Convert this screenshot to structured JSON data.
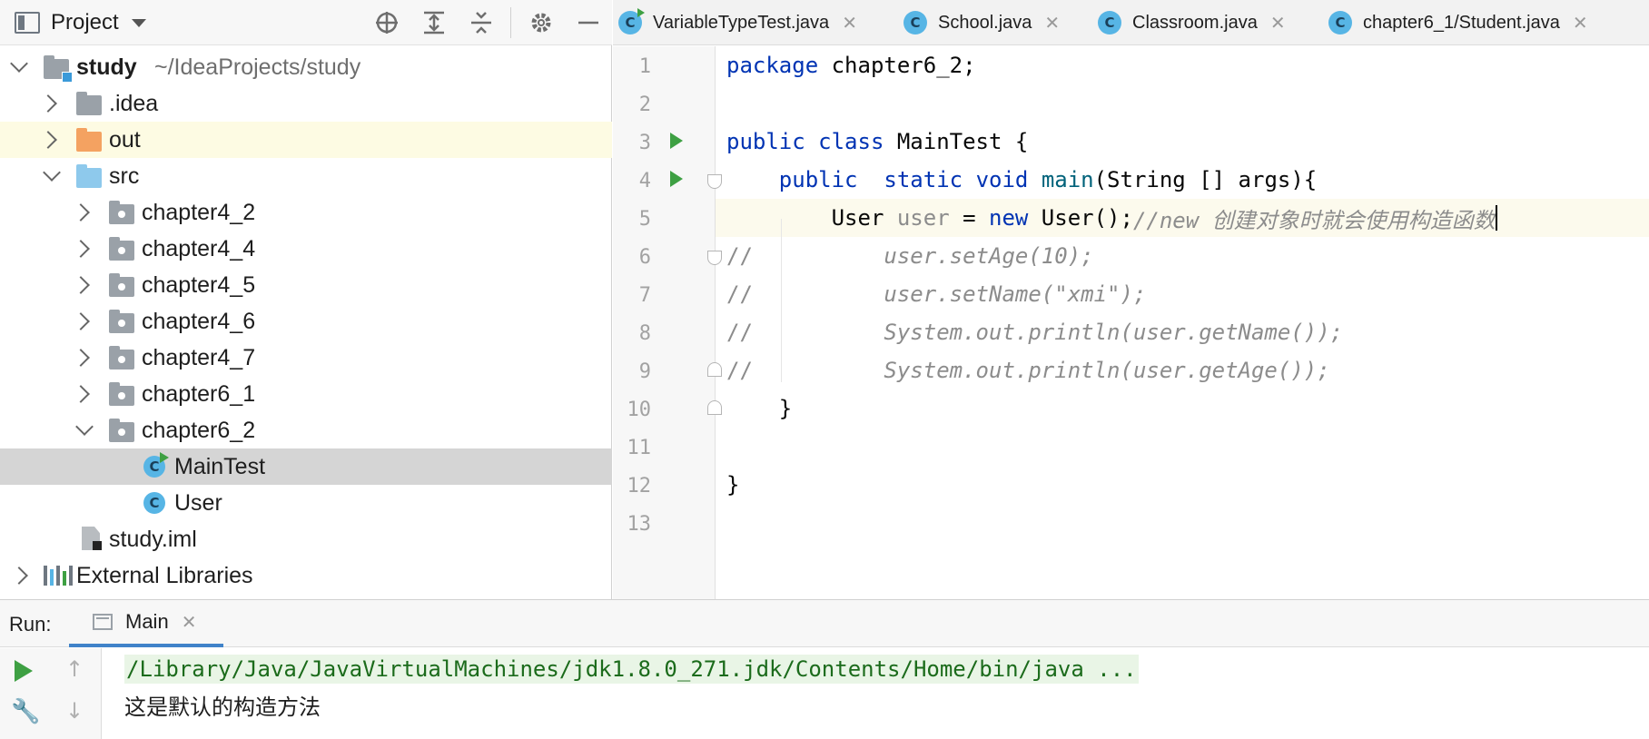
{
  "project_panel": {
    "title": "Project",
    "header_icons": [
      "locate-icon",
      "expand-all-icon",
      "collapse-all-icon",
      "gear-icon",
      "minimize-icon"
    ],
    "tree": {
      "root_name": "study",
      "root_path": "~/IdeaProjects/study",
      "idea": ".idea",
      "out": "out",
      "src": "src",
      "packages": [
        "chapter4_2",
        "chapter4_4",
        "chapter4_5",
        "chapter4_6",
        "chapter4_7",
        "chapter6_1",
        "chapter6_2"
      ],
      "class_main": "MainTest",
      "class_user": "User",
      "iml": "study.iml",
      "external_libraries": "External Libraries"
    }
  },
  "editor_tabs": [
    {
      "label": "VariableTypeTest.java",
      "icon": "C"
    },
    {
      "label": "School.java",
      "icon": "C"
    },
    {
      "label": "Classroom.java",
      "icon": "C"
    },
    {
      "label": "chapter6_1/Student.java",
      "icon": "C"
    }
  ],
  "editor": {
    "line_numbers": [
      "1",
      "2",
      "3",
      "4",
      "5",
      "6",
      "7",
      "8",
      "9",
      "10",
      "11",
      "12",
      "13"
    ],
    "code": {
      "l1_kw": "package",
      "l1_rest": " chapter6_2;",
      "l3_kw1": "public",
      "l3_kw2": "class",
      "l3_rest": " MainTest {",
      "l4_kw1": "public",
      "l4_kw2": "static",
      "l4_kw3": "void",
      "l4_mth": "main",
      "l4_rest": "(String [] args){",
      "l5_type": "User ",
      "l5_var": "user",
      "l5_eq": " = ",
      "l5_kw": "new",
      "l5_rest": " User();",
      "l5_cmt": "//new 创建对象时就会使用构造函数",
      "l6_prefix": "//",
      "l6_cmt": "user.setAge(10);",
      "l7_prefix": "//",
      "l7_cmt": "user.setName(\"xmi\");",
      "l8_prefix": "//",
      "l8_cmt": "System.out.println(user.getName());",
      "l9_prefix": "//",
      "l9_cmt": "System.out.println(user.getAge());",
      "l10": "}",
      "l12": "}"
    }
  },
  "run_panel": {
    "label": "Run:",
    "tab_label": "Main",
    "console": [
      "/Library/Java/JavaVirtualMachines/jdk1.8.0_271.jdk/Contents/Home/bin/java ...",
      "这是默认的构造方法"
    ]
  },
  "colors": {
    "keyword": "#0033b3",
    "method": "#00627a",
    "comment": "#8c8c8c",
    "run_green": "#3ea043",
    "selection": "#d5d5d5",
    "tab_underline": "#4083c9"
  }
}
